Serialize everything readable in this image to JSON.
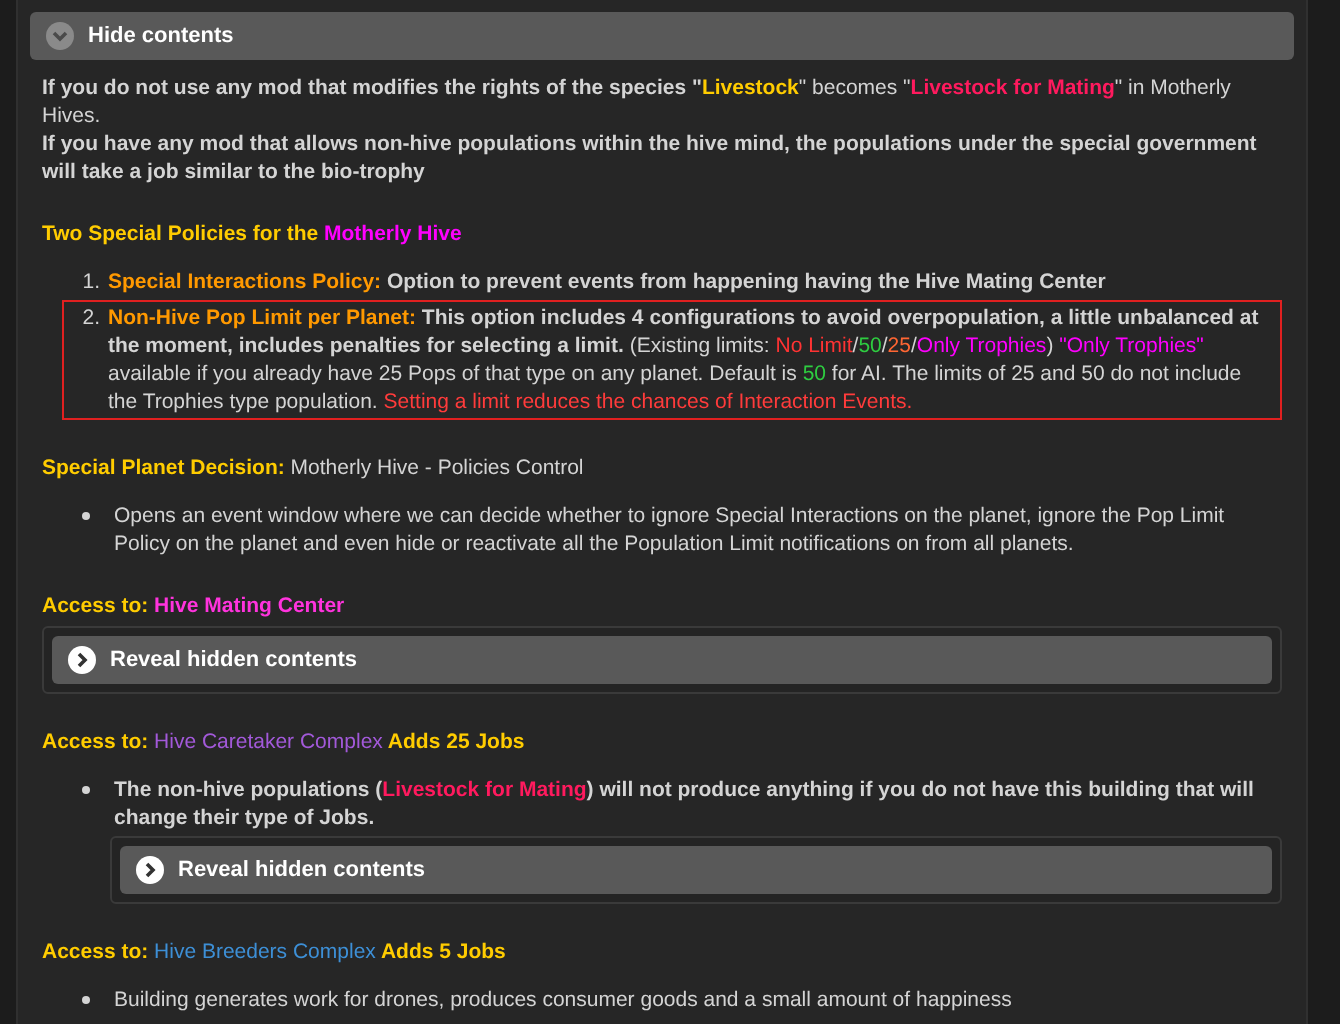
{
  "spoiler": {
    "label": "Hide contents",
    "expanded": true
  },
  "blocks": [
    {
      "kind": "text",
      "lines": [
        [
          {
            "text": "If you do not use any mod that modifies the rights of the species \"",
            "bold": true
          },
          {
            "text": "Livestock",
            "color": "#ffcc00",
            "bold": true
          },
          {
            "text": "\" becomes \"",
            "bold": false
          },
          {
            "text": "Livestock for Mating",
            "color": "#ff1a5e",
            "bold": true
          },
          {
            "text": "\" in Motherly Hives.",
            "bold": false
          }
        ],
        [
          {
            "text": "If you have any mod that allows non-hive populations within the hive mind, the populations under the special government will take a job similar to the bio-trophy",
            "bold": true
          }
        ]
      ]
    },
    {
      "kind": "heading",
      "segments": [
        {
          "text": "Two Special Policies for the ",
          "color": "#ffcc00",
          "bold": true
        },
        {
          "text": "Motherly Hive",
          "color": "#ff00ff",
          "bold": true
        }
      ]
    },
    {
      "kind": "ordered_list",
      "items": [
        {
          "number": "1.",
          "highlighted": false,
          "segments": [
            {
              "text": "Special Interactions Policy:",
              "color": "#ff9900",
              "bold": true
            },
            {
              "text": " Option to prevent events from happening having the Hive Mating Center",
              "bold": true
            }
          ]
        },
        {
          "number": "2.",
          "highlighted": true,
          "segments": [
            {
              "text": "Non-Hive Pop Limit per Planet:",
              "color": "#ff9900",
              "bold": true
            },
            {
              "text": "  This option includes 4 configurations to avoid overpopulation, a little unbalanced at the moment, includes penalties for selecting a limit.",
              "bold": true
            },
            {
              "text": " (Existing limits: ",
              "bold": false
            },
            {
              "text": "No Limit",
              "color": "#ff3333",
              "bold": false
            },
            {
              "text": "/",
              "bold": false
            },
            {
              "text": "50",
              "color": "#2ecc40",
              "bold": false
            },
            {
              "text": "/",
              "bold": false
            },
            {
              "text": "25",
              "color": "#ff6633",
              "bold": false
            },
            {
              "text": "/",
              "bold": false
            },
            {
              "text": "Only Trophies",
              "color": "#ff00ff",
              "bold": false
            },
            {
              "text": ") ",
              "bold": false
            },
            {
              "text": "\"Only Trophies\"",
              "color": "#ff00ff",
              "bold": false
            },
            {
              "text": " available if you already have 25 Pops of that type on any planet. Default is ",
              "bold": false
            },
            {
              "text": "50",
              "color": "#2ecc40",
              "bold": false
            },
            {
              "text": " for AI. The limits of 25 and 50 do not include the Trophies type population. ",
              "bold": false
            },
            {
              "text": "Setting a limit reduces the chances of Interaction Events.",
              "color": "#ff3b3b",
              "bold": false
            }
          ]
        }
      ]
    },
    {
      "kind": "heading",
      "segments": [
        {
          "text": "Special Planet Decision:",
          "color": "#ffcc00",
          "bold": true
        },
        {
          "text": " Motherly Hive - Policies Control",
          "bold": false
        }
      ]
    },
    {
      "kind": "bullet_list",
      "items": [
        {
          "kind": "bullet",
          "segments": [
            {
              "text": "Opens an event window where we can decide whether to ignore Special Interactions on the planet, ignore the Pop Limit Policy on the planet and even hide or reactivate all the Population Limit notifications on from all planets.",
              "bold": false
            }
          ]
        }
      ]
    },
    {
      "kind": "heading",
      "segments": [
        {
          "text": "Access to: ",
          "color": "#ffcc00",
          "bold": true
        },
        {
          "text": "Hive Mating Center",
          "color": "#ff33dd",
          "bold": true
        }
      ]
    },
    {
      "kind": "spoiler",
      "label": "Reveal hidden contents",
      "expanded": false
    },
    {
      "kind": "heading",
      "segments": [
        {
          "text": "Access to: ",
          "color": "#ffcc00",
          "bold": true
        },
        {
          "text": "Hive Caretaker Complex",
          "color": "#a259d9",
          "bold": false
        },
        {
          "text": " Adds 25 Jobs",
          "color": "#ffcc00",
          "bold": true
        }
      ]
    },
    {
      "kind": "bullet_list",
      "items": [
        {
          "kind": "bullet",
          "segments": [
            {
              "text": "The non-hive populations (",
              "bold": true
            },
            {
              "text": "Livestock for Mating",
              "color": "#ff1a5e",
              "bold": true
            },
            {
              "text": ") will not produce anything if you do not have this building that will change their type of Jobs.",
              "bold": true
            }
          ]
        },
        {
          "kind": "spoiler",
          "label": "Reveal hidden contents",
          "expanded": false
        }
      ]
    },
    {
      "kind": "heading",
      "segments": [
        {
          "text": "Access to: ",
          "color": "#ffcc00",
          "bold": true
        },
        {
          "text": "Hive Breeders Complex",
          "color": "#3d8fd6",
          "bold": false
        },
        {
          "text": " Adds 5 Jobs",
          "color": "#ffcc00",
          "bold": true
        }
      ]
    },
    {
      "kind": "bullet_list",
      "items": [
        {
          "kind": "bullet",
          "segments": [
            {
              "text": "Building generates work for drones, produces consumer goods and a small amount of happiness",
              "bold": false
            }
          ]
        }
      ]
    }
  ]
}
